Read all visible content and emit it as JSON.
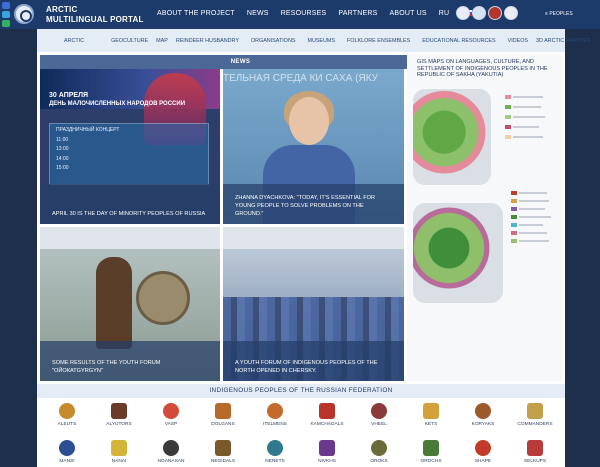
{
  "brand": {
    "line1": "ARCTIC",
    "line2": "MULTILINGUAL PORTAL"
  },
  "topnav": [
    "ABOUT THE PROJECT",
    "NEWS",
    "RESOURSES",
    "PARTNERS",
    "ABOUT US",
    "RU"
  ],
  "people_label": "PEOPLES",
  "subnav": [
    "ARCTIC",
    "GEOCULTURE",
    "MAP",
    "REINDEER HUSBANDRY",
    "ORGANISATIONS",
    "MUSEUMS",
    "FOLKLORE ENSEMBLES",
    "EDUCATIONAL RESOURCES",
    "VIDEOS",
    "3D ARCTIC RARITIES"
  ],
  "news": {
    "heading": "NEWS",
    "cards": [
      {
        "caption": "APRIL 30 IS THE DAY OF MINORITY PEOPLES OF RUSSIA",
        "poster_title": "30 АПРЕЛЯ",
        "poster_sub": "ДЕНЬ МАЛОЧИСЛЕННЫХ НАРОДОВ РОССИИ",
        "poster_box": [
          "ПРАЗДНИЧНЫЙ КОНЦЕРТ",
          "11:00",
          "13:00",
          "14:00",
          "15:00"
        ]
      },
      {
        "caption": "ZHANNA DYACHKOVA: \"TODAY, IT'S ESSENTIAL FOR YOUNG PEOPLE TO SOLVE PROBLEMS ON THE GROUND.\"",
        "banner": "ТЕЛЬНАЯ СРЕДА КИ САХА (ЯКУ"
      },
      {
        "caption": "SOME RESULTS OF THE YOUTH FORUM \"ОЙОКАТGYRGYN\""
      },
      {
        "caption": "A YOUTH FORUM OF INDIGENOUS PEOPLES OF THE NORTH OPENED IN CHERSKY."
      }
    ]
  },
  "gis": {
    "title": "GIS MAPS ON LANGUAGES, CULTURE, AND SETTLEMENT OF INDIGENOUS PEOPLES IN THE REPUBLIC OF SAKHA (YAKUTIA)"
  },
  "peoples": {
    "heading": "INDIGENOUS PEOPLES OF THE RUSSIAN FEDERATION",
    "row1": [
      "ALEUTS",
      "ALYUTORS",
      "VASP",
      "DOLGANS",
      "ITELMENS",
      "KAMCHADALS",
      "VHEEL",
      "KETS",
      "KORYAKS",
      "COMMANDERS"
    ],
    "row2": [
      "MANSI",
      "NANAI",
      "NGANASAN",
      "NEGIDALS",
      "NENETS",
      "NIVKHS",
      "OROKS",
      "OROCHS",
      "SHAPE",
      "SELKUPS"
    ],
    "colors1": [
      "#c58a2b",
      "#6b3b2a",
      "#d14a3a",
      "#b86a2a",
      "#c46b2b",
      "#b8342a",
      "#8a3a3a",
      "#d3a03a",
      "#9a5a2a",
      "#c2a04a"
    ],
    "colors2": [
      "#2c4f8f",
      "#d3b53a",
      "#3a3a3a",
      "#7a5a2a",
      "#2f7a8f",
      "#6a3a8a",
      "#6a6a3a",
      "#4a7a3a",
      "#c23a2a",
      "#b83a3a"
    ]
  }
}
